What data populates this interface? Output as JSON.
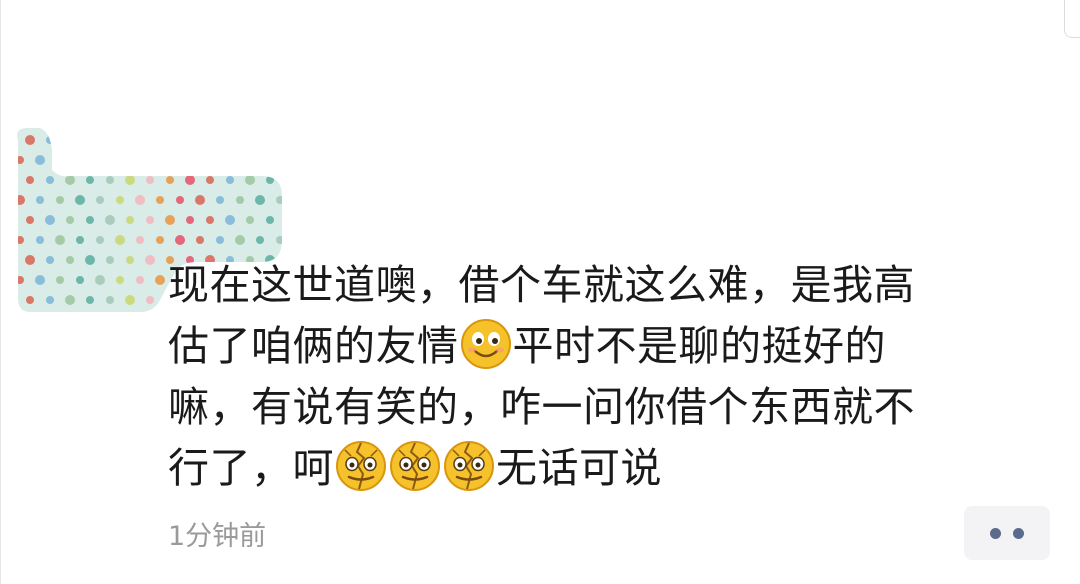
{
  "post": {
    "lines": [
      "现在这世道噢，借个车就这么难，是我高",
      "估了咱俩的友情",
      "平时不是聊的挺好的",
      "嘛，有说有笑的，咋一问你借个东西就不",
      "行了，呵",
      "无话可说"
    ],
    "emojis": [
      "smile-emoji",
      "cracked-face-emoji",
      "cracked-face-emoji",
      "cracked-face-emoji"
    ]
  },
  "meta": {
    "timestamp": "1分钟前"
  },
  "colors": {
    "text": "#1a1a1a",
    "timestamp": "#9a9a9a",
    "more_button_bg": "#f3f3f5",
    "more_button_dots": "#5a6b8c",
    "emoji_yellow": "#f6c22b"
  },
  "icons": {
    "more": "more-dots-icon",
    "avatar": "polka-dot-avatar-mask"
  }
}
